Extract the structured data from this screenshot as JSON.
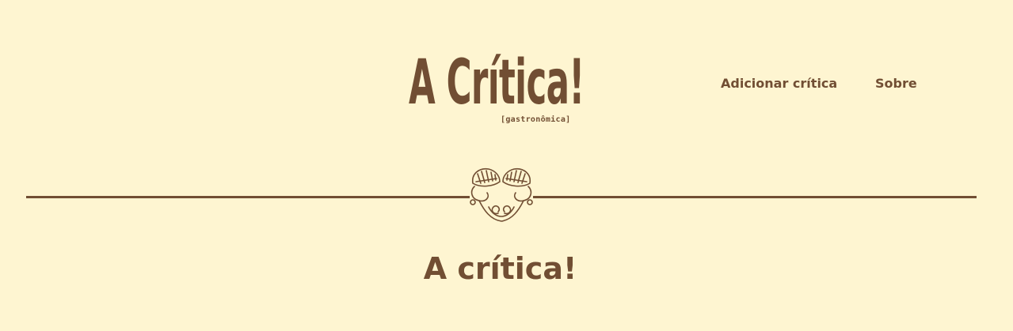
{
  "brand": {
    "title": "A Crítica!",
    "subtitle": "[gastronômica]"
  },
  "nav": {
    "items": [
      {
        "label": "Adicionar crítica"
      },
      {
        "label": "Sobre"
      }
    ]
  },
  "divider": {
    "ornament_icon": "leaf-ornament-icon"
  },
  "main": {
    "heading": "A crítica!"
  },
  "colors": {
    "background": "#fef5d1",
    "brand_brown": "#714e33"
  }
}
